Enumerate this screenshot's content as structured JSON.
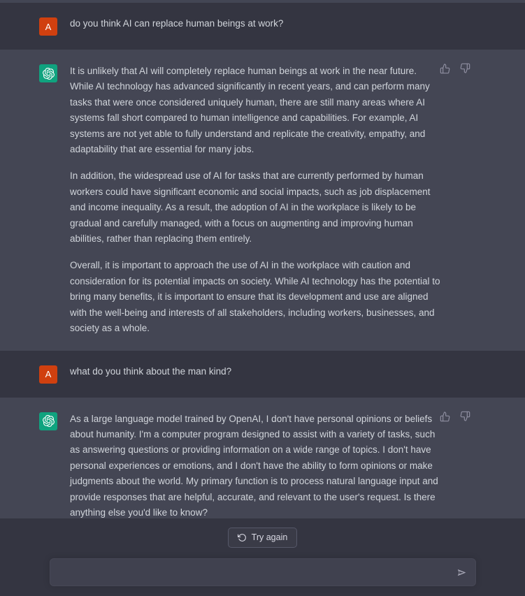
{
  "theme": {
    "page_background": "#343541",
    "user_row_background": "#343541",
    "assistant_row_background": "#444654",
    "text_color": "#d1d5db",
    "user_avatar_color": "#d0400f",
    "assistant_avatar_color": "#10a37f",
    "icon_color": "#8e8ea0",
    "composer_background": "#40414f",
    "composer_border": "#474856"
  },
  "conversation": {
    "messages": [
      {
        "role": "user",
        "avatar_label": "A",
        "avatar_icon": "user-avatar-letter",
        "paragraphs": [
          "do you think AI can replace human beings at work?"
        ]
      },
      {
        "role": "assistant",
        "avatar_icon": "openai-logo-icon",
        "paragraphs": [
          "It is unlikely that AI will completely replace human beings at work in the near future. While AI technology has advanced significantly in recent years, and can perform many tasks that were once considered uniquely human, there are still many areas where AI systems fall short compared to human intelligence and capabilities. For example, AI systems are not yet able to fully understand and replicate the creativity, empathy, and adaptability that are essential for many jobs.",
          "In addition, the widespread use of AI for tasks that are currently performed by human workers could have significant economic and social impacts, such as job displacement and income inequality. As a result, the adoption of AI in the workplace is likely to be gradual and carefully managed, with a focus on augmenting and improving human abilities, rather than replacing them entirely.",
          "Overall, it is important to approach the use of AI in the workplace with caution and consideration for its potential impacts on society. While AI technology has the potential to bring many benefits, it is important to ensure that its development and use are aligned with the well-being and interests of all stakeholders, including workers, businesses, and society as a whole."
        ],
        "feedback": {
          "thumbs_up_icon": "thumbs-up-icon",
          "thumbs_down_icon": "thumbs-down-icon"
        }
      },
      {
        "role": "user",
        "avatar_label": "A",
        "avatar_icon": "user-avatar-letter",
        "paragraphs": [
          "what do you think about the man kind?"
        ]
      },
      {
        "role": "assistant",
        "avatar_icon": "openai-logo-icon",
        "paragraphs": [
          "As a large language model trained by OpenAI, I don't have personal opinions or beliefs about humanity. I'm a computer program designed to assist with a variety of tasks, such as answering questions or providing information on a wide range of topics. I don't have personal experiences or emotions, and I don't have the ability to form opinions or make judgments about the world. My primary function is to process natural language input and provide responses that are helpful, accurate, and relevant to the user's request. Is there anything else you'd like to know?"
        ],
        "feedback": {
          "thumbs_up_icon": "thumbs-up-icon",
          "thumbs_down_icon": "thumbs-down-icon"
        }
      }
    ]
  },
  "footer": {
    "regenerate": {
      "label": "Try again",
      "icon": "refresh-icon"
    },
    "composer": {
      "value": "",
      "placeholder": "",
      "send_icon": "send-arrow-icon"
    }
  }
}
